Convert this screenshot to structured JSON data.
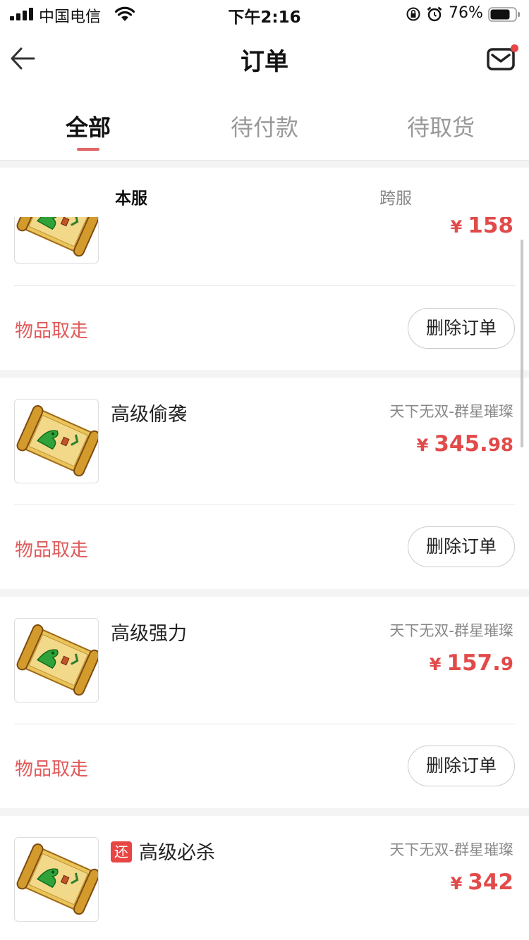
{
  "status_bar": {
    "carrier": "中国电信",
    "time": "下午2:16",
    "battery": "76%",
    "icons": [
      "signal-icon",
      "wifi-icon",
      "orientation-lock-icon",
      "alarm-icon",
      "battery-icon"
    ]
  },
  "nav": {
    "title": "订单",
    "back_icon": "back-arrow-icon",
    "mail_icon": "mail-icon"
  },
  "tabs": [
    {
      "label": "全部",
      "active": true
    },
    {
      "label": "待付款",
      "active": false
    },
    {
      "label": "待取货",
      "active": false
    }
  ],
  "sub_tabs": [
    {
      "label": "本服",
      "active": true
    },
    {
      "label": "跨服",
      "active": false
    }
  ],
  "orders": [
    {
      "name": "",
      "server": "",
      "currency": "¥",
      "price_int": "158",
      "price_dec": "",
      "status": "物品取走",
      "action": "删除订单",
      "tag": ""
    },
    {
      "name": "高级偷袭",
      "server": "天下无双-群星璀璨",
      "currency": "¥",
      "price_int": "345.",
      "price_dec": "98",
      "status": "物品取走",
      "action": "删除订单",
      "tag": ""
    },
    {
      "name": "高级强力",
      "server": "天下无双-群星璀璨",
      "currency": "¥",
      "price_int": "157.",
      "price_dec": "9",
      "status": "物品取走",
      "action": "删除订单",
      "tag": ""
    },
    {
      "name": "高级必杀",
      "server": "天下无双-群星璀璨",
      "currency": "¥",
      "price_int": "342",
      "price_dec": "",
      "status": "",
      "action": "",
      "tag": "还"
    }
  ],
  "colors": {
    "accent": "#e24a4a",
    "status_text": "#e05a5a",
    "tab_underline": "#e06767"
  }
}
